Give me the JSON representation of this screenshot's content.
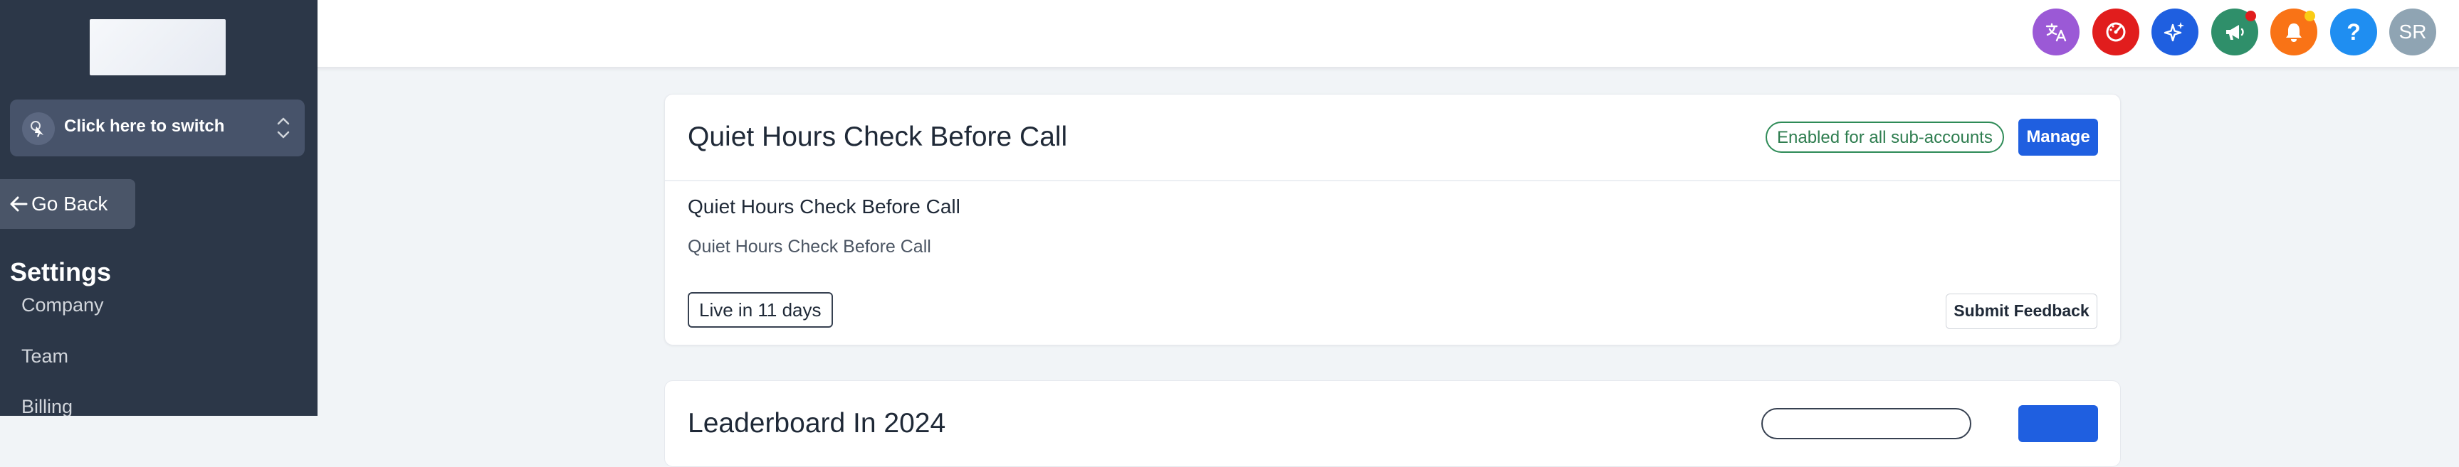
{
  "sidebar": {
    "switcher_label": "Click here to switch",
    "go_back_label": "Go Back",
    "settings_title": "Settings",
    "nav_items": [
      {
        "label": "Company"
      },
      {
        "label": "Team"
      },
      {
        "label": "Billing"
      }
    ]
  },
  "topbar": {
    "buttons": [
      {
        "icon": "translate-icon",
        "color": "#9b59d6"
      },
      {
        "icon": "speedometer-icon",
        "color": "#e11d1d"
      },
      {
        "icon": "sparkles-icon",
        "color": "#1f5fe0"
      },
      {
        "icon": "megaphone-icon",
        "color": "#2f8f6a",
        "badge_color": "#e11d1d"
      },
      {
        "icon": "bell-icon",
        "color": "#f97316",
        "badge_color": "#facc15"
      },
      {
        "icon": "help-icon",
        "color": "#1f8ef1",
        "text": "?"
      },
      {
        "icon": "avatar",
        "color": "#8fa4b3",
        "text": "SR"
      }
    ]
  },
  "card": {
    "title": "Quiet Hours Check Before Call",
    "enabled_badge": "Enabled for all sub-accounts",
    "manage_label": "Manage",
    "subtitle": "Quiet Hours Check Before Call",
    "description": "Quiet Hours Check Before Call",
    "live_badge": "Live in 11 days",
    "feedback_label": "Submit Feedback"
  },
  "card2": {
    "title": "Leaderboard In 2024"
  }
}
